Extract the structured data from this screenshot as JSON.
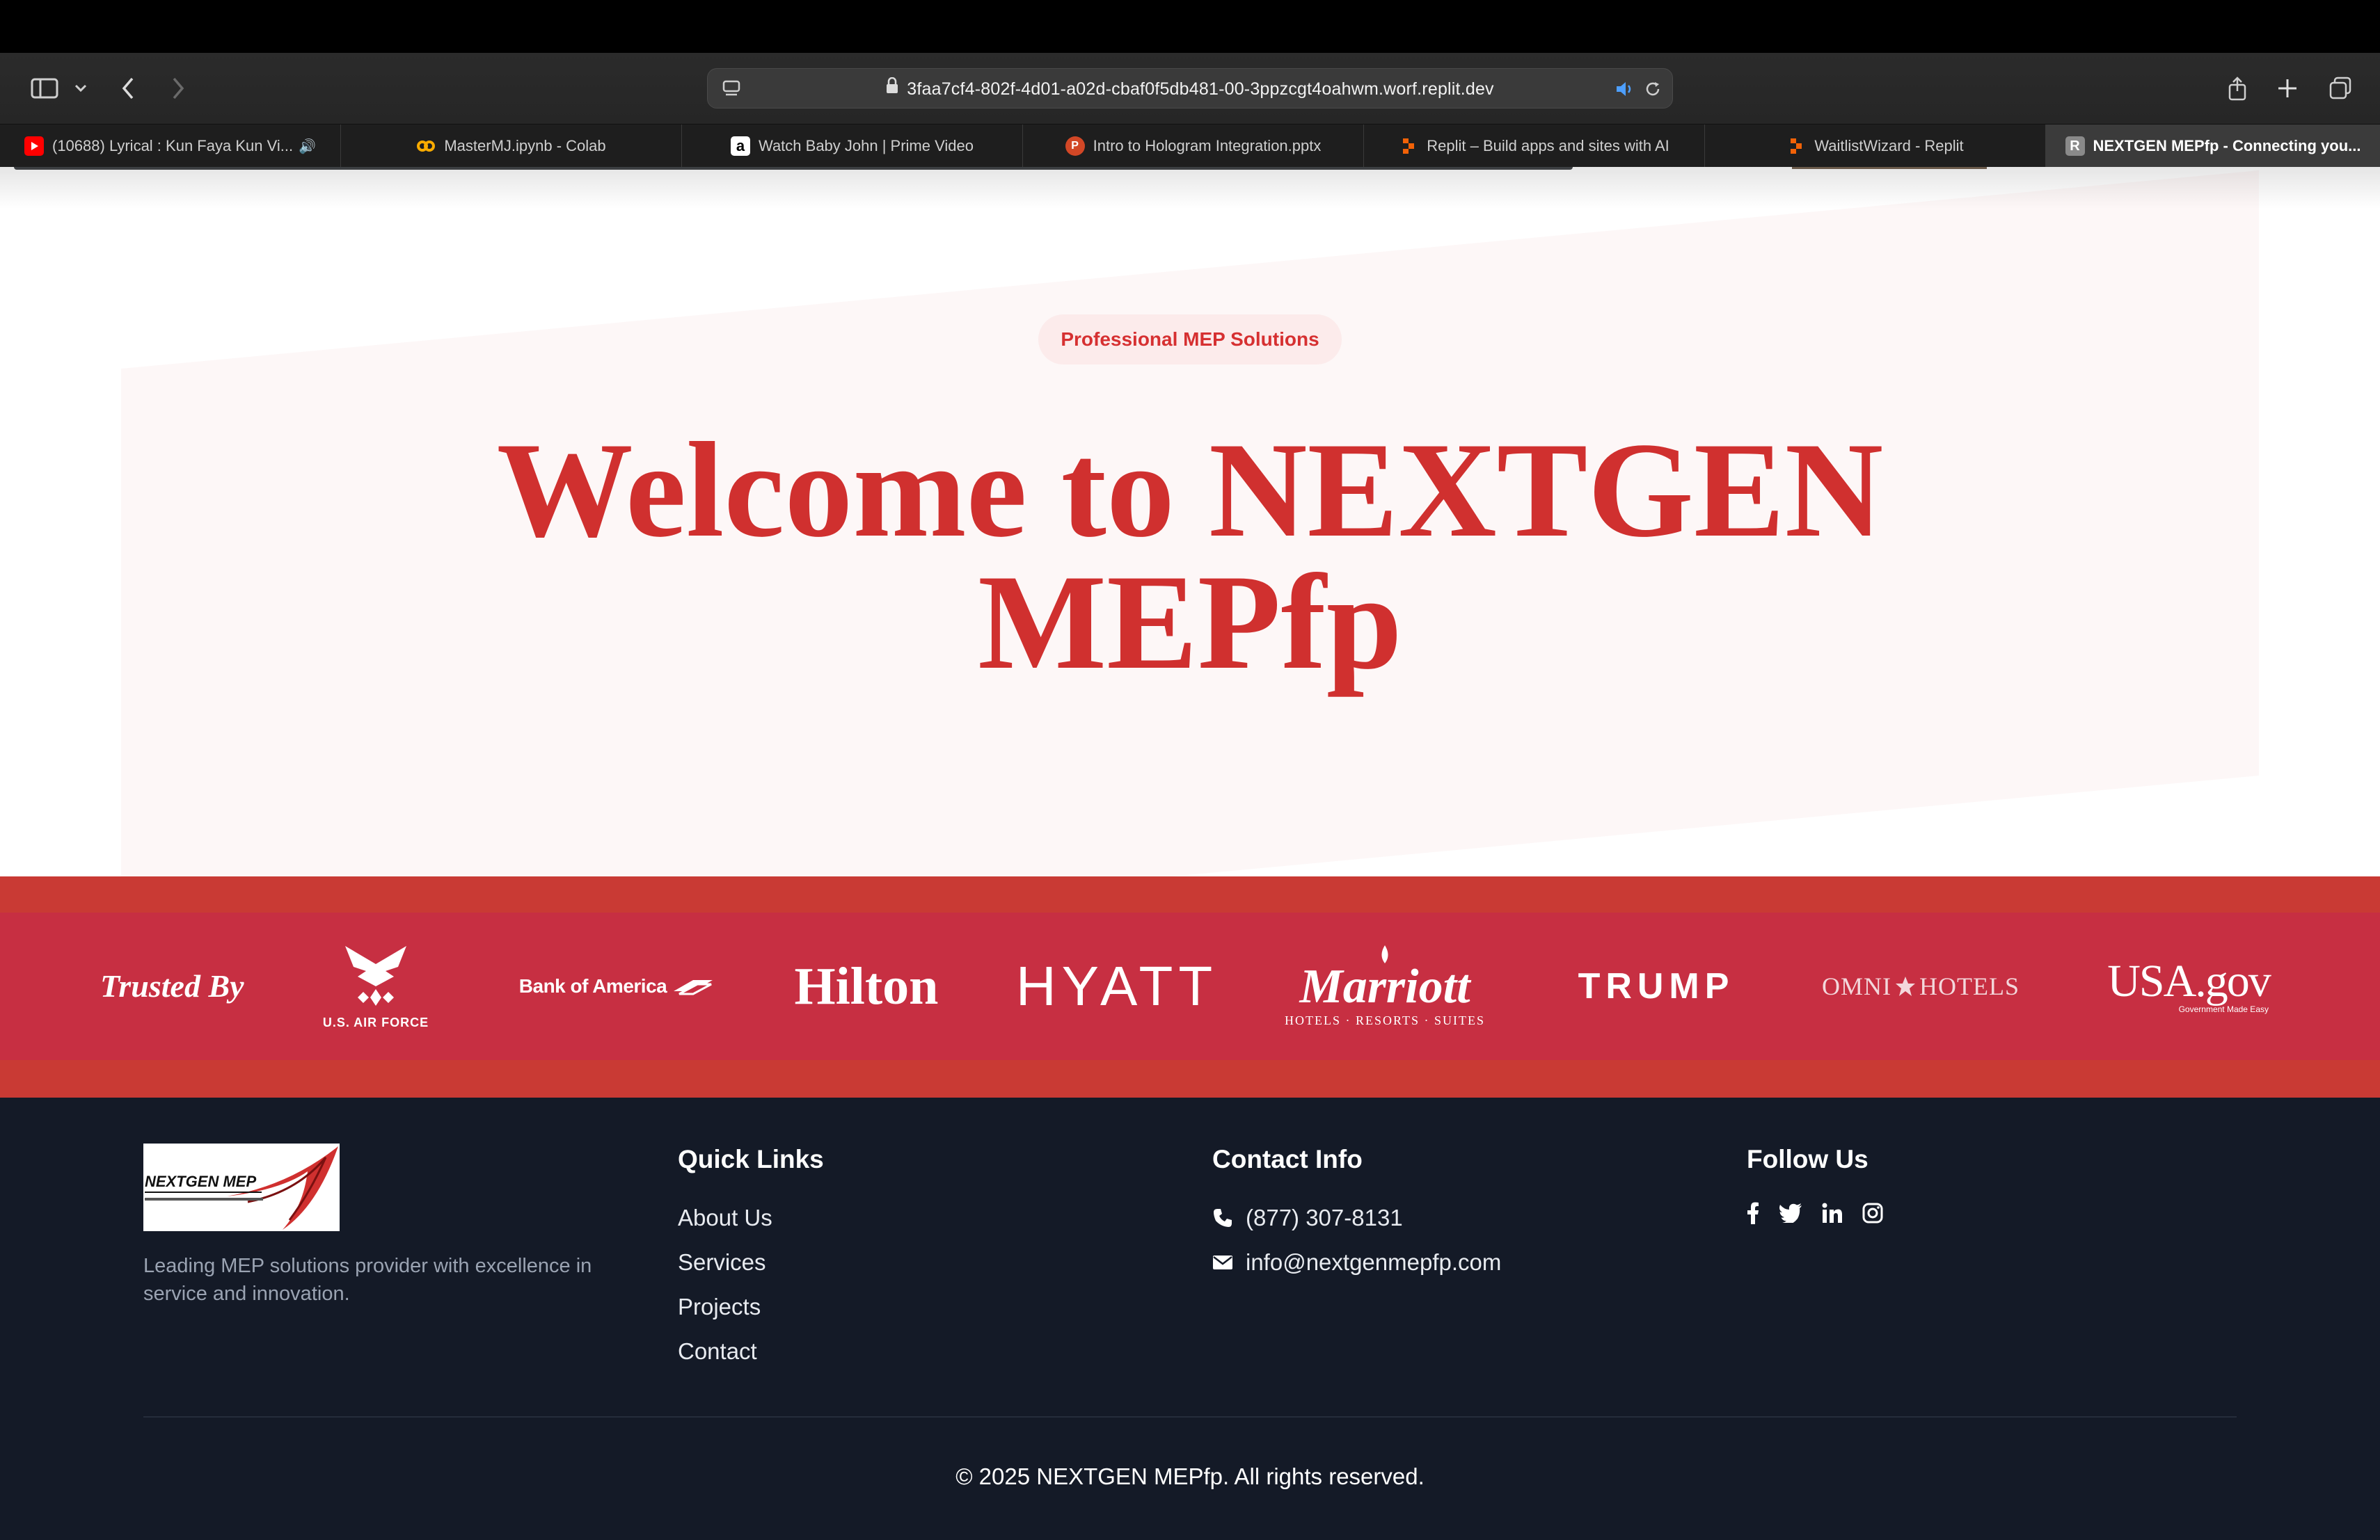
{
  "browser": {
    "url": "3faa7cf4-802f-4d01-a02d-cbaf0f5db481-00-3ppzcgt4oahwm.worf.replit.dev",
    "tabs": [
      {
        "label": "(10688) Lyrical : Kun Faya Kun Vi...",
        "favicon": "youtube-icon",
        "color": "#ff0000",
        "audio": "🔊"
      },
      {
        "label": "MasterMJ.ipynb - Colab",
        "favicon": "colab-icon",
        "color": "#f9ab00"
      },
      {
        "label": "Watch Baby John | Prime Video",
        "favicon": "amazon-icon",
        "color": "#ffffff"
      },
      {
        "label": "Intro to Hologram Integration.pptx",
        "favicon": "powerpoint-icon",
        "color": "#d24726"
      },
      {
        "label": "Replit – Build apps and sites with AI",
        "favicon": "replit-icon",
        "color": "#f26207"
      },
      {
        "label": "WaitlistWizard - Replit",
        "favicon": "replit-icon",
        "color": "#f26207"
      },
      {
        "label": "NEXTGEN MEPfp - Connecting you...",
        "favicon": "r-icon",
        "favicon_letter": "R",
        "color": "#888888"
      }
    ]
  },
  "hero": {
    "badge": "Professional MEP Solutions",
    "title": "Welcome to NEXTGEN MEPfp"
  },
  "trusted": {
    "label": "Trusted By",
    "logos": [
      "U.S. AIR FORCE",
      "Bank of America",
      "Hilton",
      "HYATT",
      "Marriott",
      "HOTELS · RESORTS · SUITES",
      "TRUMP",
      "OMNI",
      "HOTELS",
      "USA.gov",
      "Government Made Easy"
    ]
  },
  "footer": {
    "logo_text": "NEXTGEN MEP",
    "description": "Leading MEP solutions provider with excellence in service and innovation.",
    "quick_links_title": "Quick Links",
    "quick_links": [
      "About Us",
      "Services",
      "Projects",
      "Contact"
    ],
    "contact_title": "Contact Info",
    "phone": "(877) 307-8131",
    "email": "info@nextgenmepfp.com",
    "follow_title": "Follow Us",
    "social": [
      "facebook-icon",
      "twitter-icon",
      "linkedin-icon",
      "instagram-icon"
    ],
    "copyright": "© 2025 NEXTGEN MEPfp. All rights reserved."
  },
  "colors": {
    "accent": "#d0302f",
    "band": "#c72f42",
    "footer_bg": "#141a27"
  }
}
